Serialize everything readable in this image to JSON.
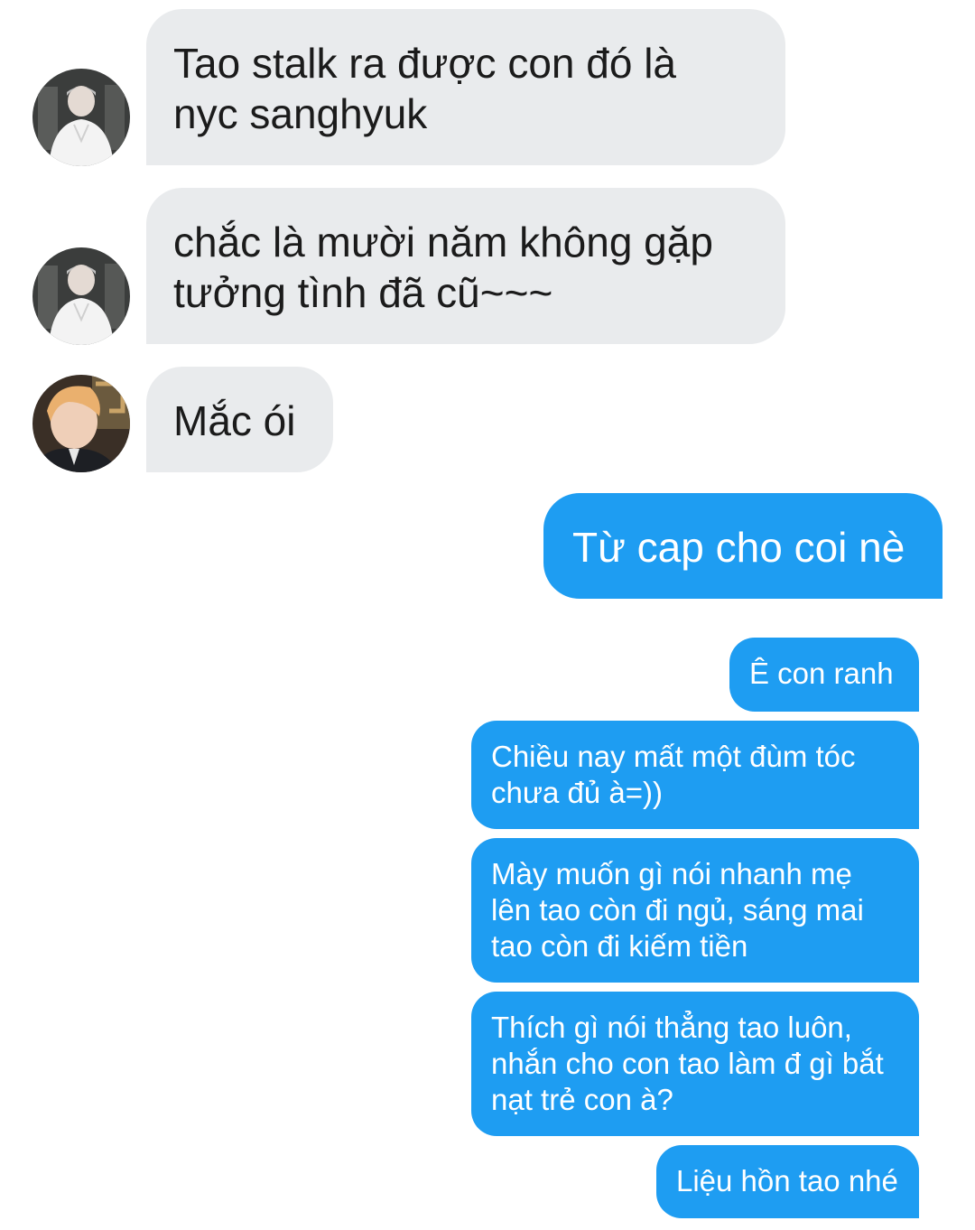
{
  "messages": [
    {
      "side": "in",
      "avatar": "contact-a-avatar",
      "text": "Tao stalk ra được con đó là\nnyc sanghyuk"
    },
    {
      "side": "in",
      "avatar": "contact-a-avatar",
      "text": "chắc là mười năm không gặp\ntưởng tình đã cũ~~~"
    },
    {
      "side": "in",
      "avatar": "contact-b-avatar",
      "text": "Mắc ói"
    },
    {
      "side": "out",
      "text": "Từ cap cho coi nè"
    },
    {
      "side": "out",
      "text": "Ê con ranh"
    },
    {
      "side": "out",
      "text": "Chiều nay mất một đùm tóc\nchưa đủ à=))"
    },
    {
      "side": "out",
      "text": "Mày muốn gì nói nhanh mẹ\nlên tao còn đi ngủ, sáng mai\ntao còn đi kiếm tiền"
    },
    {
      "side": "out",
      "text": "Thích gì nói thẳng tao luôn,\nnhắn cho con tao làm đ gì bắt\nnạt trẻ con à?"
    },
    {
      "side": "out",
      "text": "Liệu hồn tao nhé"
    }
  ],
  "colors": {
    "incoming_bubble": "#e9ebed",
    "outgoing_bubble": "#1e9df2",
    "incoming_text": "#1b1b1b",
    "outgoing_text": "#ffffff"
  }
}
